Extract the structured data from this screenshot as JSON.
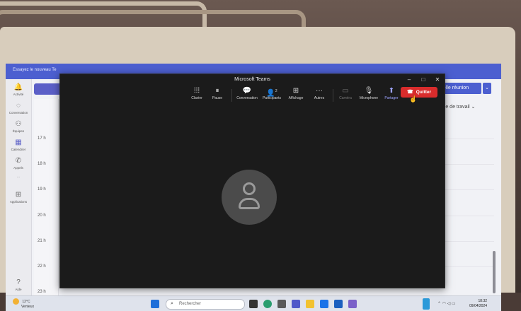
{
  "teams_bg": {
    "trial_text": "Essayez le nouveau Te",
    "new_meeting_label": "elle réunion",
    "workweek_label": "aine de travail",
    "rail": [
      {
        "label": "Activité",
        "icon": "bell-icon"
      },
      {
        "label": "Conversation",
        "icon": "chat-icon"
      },
      {
        "label": "Équipes",
        "icon": "teams-icon"
      },
      {
        "label": "Calendrier",
        "icon": "calendar-icon"
      },
      {
        "label": "Appels",
        "icon": "phone-icon"
      },
      {
        "label": "···",
        "icon": "more-icon"
      },
      {
        "label": "Applications",
        "icon": "apps-icon"
      },
      {
        "label": "Aide",
        "icon": "help-icon"
      }
    ],
    "hours": [
      "17 h",
      "18 h",
      "19 h",
      "20 h",
      "21 h",
      "22 h",
      "23 h"
    ]
  },
  "meeting_window": {
    "title": "Microsoft Teams",
    "toolbar": [
      {
        "label": "Clavier",
        "icon": "keypad-icon",
        "glyph": "⁞⁞⁞",
        "state": "normal"
      },
      {
        "label": "Pause",
        "icon": "pause-icon",
        "glyph": "⏸",
        "state": "normal"
      },
      {
        "label": "Conversation",
        "icon": "chat-icon",
        "glyph": "💬",
        "state": "normal"
      },
      {
        "label": "Participants",
        "icon": "people-icon",
        "glyph": "👤",
        "count": "2",
        "state": "normal"
      },
      {
        "label": "Affichage",
        "icon": "grid-icon",
        "glyph": "⊞",
        "state": "normal"
      },
      {
        "label": "Autres",
        "icon": "more-icon",
        "glyph": "···",
        "state": "normal"
      },
      {
        "label": "Caméra",
        "icon": "camera-icon",
        "glyph": "▭",
        "state": "disabled"
      },
      {
        "label": "Microphone",
        "icon": "microphone-icon",
        "glyph": "🎙",
        "state": "normal"
      },
      {
        "label": "Partager",
        "icon": "share-icon",
        "glyph": "⬆",
        "state": "accent"
      }
    ],
    "quit_label": "Quitter"
  },
  "taskbar": {
    "weather_temp": "12°C",
    "weather_desc": "Venteux",
    "search_placeholder": "Rechercher",
    "time": "18:32",
    "date": "09/04/2024"
  }
}
